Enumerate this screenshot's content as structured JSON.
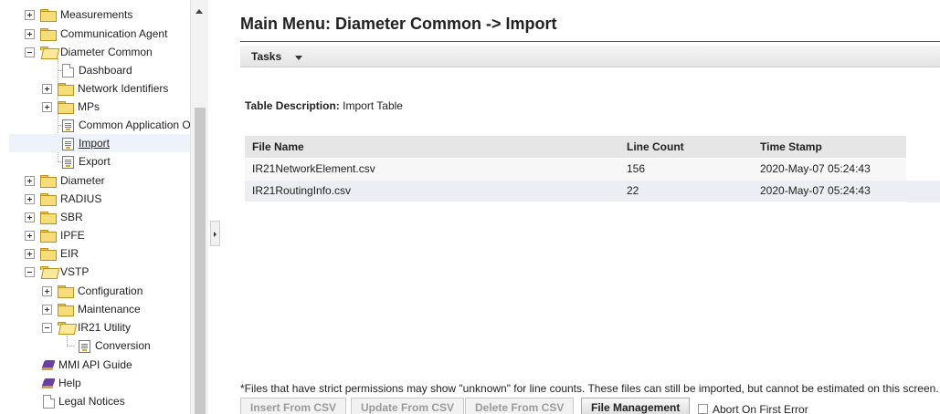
{
  "tree": {
    "items": [
      {
        "label": "Measurements",
        "icon": "folder-icon",
        "toggle": "plus"
      },
      {
        "label": "Communication Agent",
        "icon": "folder-icon",
        "toggle": "plus"
      },
      {
        "label": "Diameter Common",
        "icon": "folder-open-icon",
        "toggle": "minus"
      },
      {
        "label": "Dashboard",
        "icon": "page-icon"
      },
      {
        "label": "Network Identifiers",
        "icon": "folder-icon",
        "toggle": "plus"
      },
      {
        "label": "MPs",
        "icon": "folder-icon",
        "toggle": "plus"
      },
      {
        "label": "Common Application O|",
        "icon": "form-icon"
      },
      {
        "label": "Import",
        "icon": "form-icon",
        "selected": true
      },
      {
        "label": "Export",
        "icon": "form-icon"
      },
      {
        "label": "Diameter",
        "icon": "folder-icon",
        "toggle": "plus"
      },
      {
        "label": "RADIUS",
        "icon": "folder-icon",
        "toggle": "plus"
      },
      {
        "label": "SBR",
        "icon": "folder-icon",
        "toggle": "plus"
      },
      {
        "label": "IPFE",
        "icon": "folder-icon",
        "toggle": "plus"
      },
      {
        "label": "EIR",
        "icon": "folder-icon",
        "toggle": "plus"
      },
      {
        "label": "VSTP",
        "icon": "folder-open-icon",
        "toggle": "minus"
      },
      {
        "label": "Configuration",
        "icon": "folder-icon",
        "toggle": "plus"
      },
      {
        "label": "Maintenance",
        "icon": "folder-icon",
        "toggle": "plus"
      },
      {
        "label": "IR21 Utility",
        "icon": "folder-open-icon",
        "toggle": "minus"
      },
      {
        "label": "Conversion",
        "icon": "form-icon"
      },
      {
        "label": "MMI API Guide",
        "icon": "book-icon"
      },
      {
        "label": "Help",
        "icon": "book-icon"
      },
      {
        "label": "Legal Notices",
        "icon": "page-icon"
      }
    ]
  },
  "main": {
    "title": "Main Menu: Diameter Common -> Import",
    "tasks_label": "Tasks",
    "table_description_label": "Table Description:",
    "table_description_value": "Import Table",
    "table": {
      "columns": [
        "File Name",
        "Line Count",
        "Time Stamp"
      ],
      "rows": [
        [
          "IR21NetworkElement.csv",
          "156",
          "2020-May-07 05:24:43"
        ],
        [
          "IR21RoutingInfo.csv",
          "22",
          "2020-May-07 05:24:43"
        ]
      ]
    },
    "footnote": "*Files that have strict permissions may show \"unknown\" for line counts. These files can still be imported, but cannot be estimated on this screen.",
    "buttons": {
      "insert": "Insert From CSV",
      "update": "Update From CSV",
      "delete": "Delete From CSV",
      "file_management": "File Management"
    },
    "abort_label": "Abort On First Error"
  }
}
